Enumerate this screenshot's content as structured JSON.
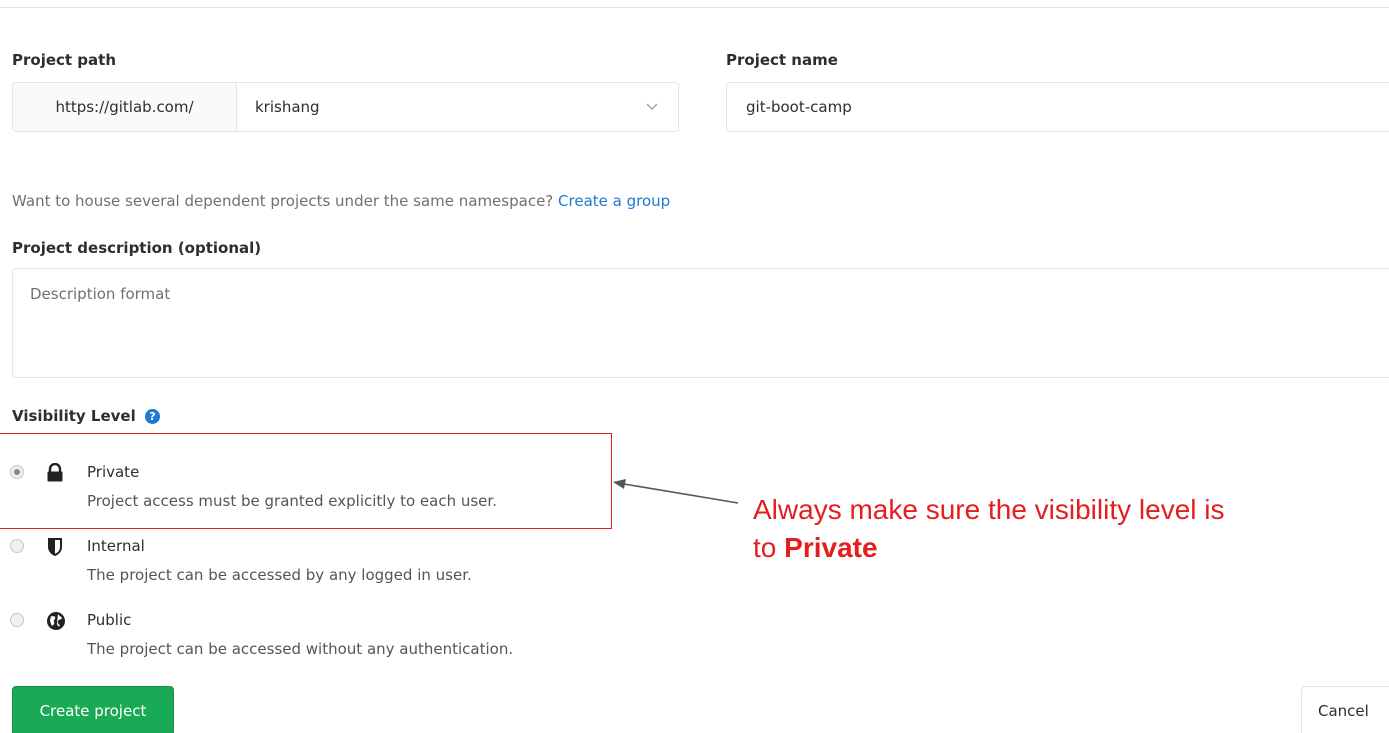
{
  "project_path": {
    "label": "Project path",
    "url_prefix": "https://gitlab.com/",
    "namespace": "krishang"
  },
  "project_name": {
    "label": "Project name",
    "value": "git-boot-camp"
  },
  "group_hint": {
    "text": "Want to house several dependent projects under the same namespace?",
    "link": "Create a group"
  },
  "description": {
    "label": "Project description (optional)",
    "placeholder": "Description format"
  },
  "visibility": {
    "label": "Visibility Level",
    "options": [
      {
        "title": "Private",
        "description": "Project access must be granted explicitly to each user.",
        "icon": "lock-icon",
        "selected": true
      },
      {
        "title": "Internal",
        "description": "The project can be accessed by any logged in user.",
        "icon": "shield-icon",
        "selected": false
      },
      {
        "title": "Public",
        "description": "The project can be accessed without any authentication.",
        "icon": "globe-icon",
        "selected": false
      }
    ]
  },
  "annotation": {
    "line1": "Always make sure the visibility level is",
    "line2_prefix": "to",
    "line2_bold": "Private",
    "color": "#e41e1e"
  },
  "actions": {
    "create": "Create project",
    "cancel": "Cancel"
  },
  "colors": {
    "primary": "#1aaa55",
    "link": "#1f78d1"
  }
}
